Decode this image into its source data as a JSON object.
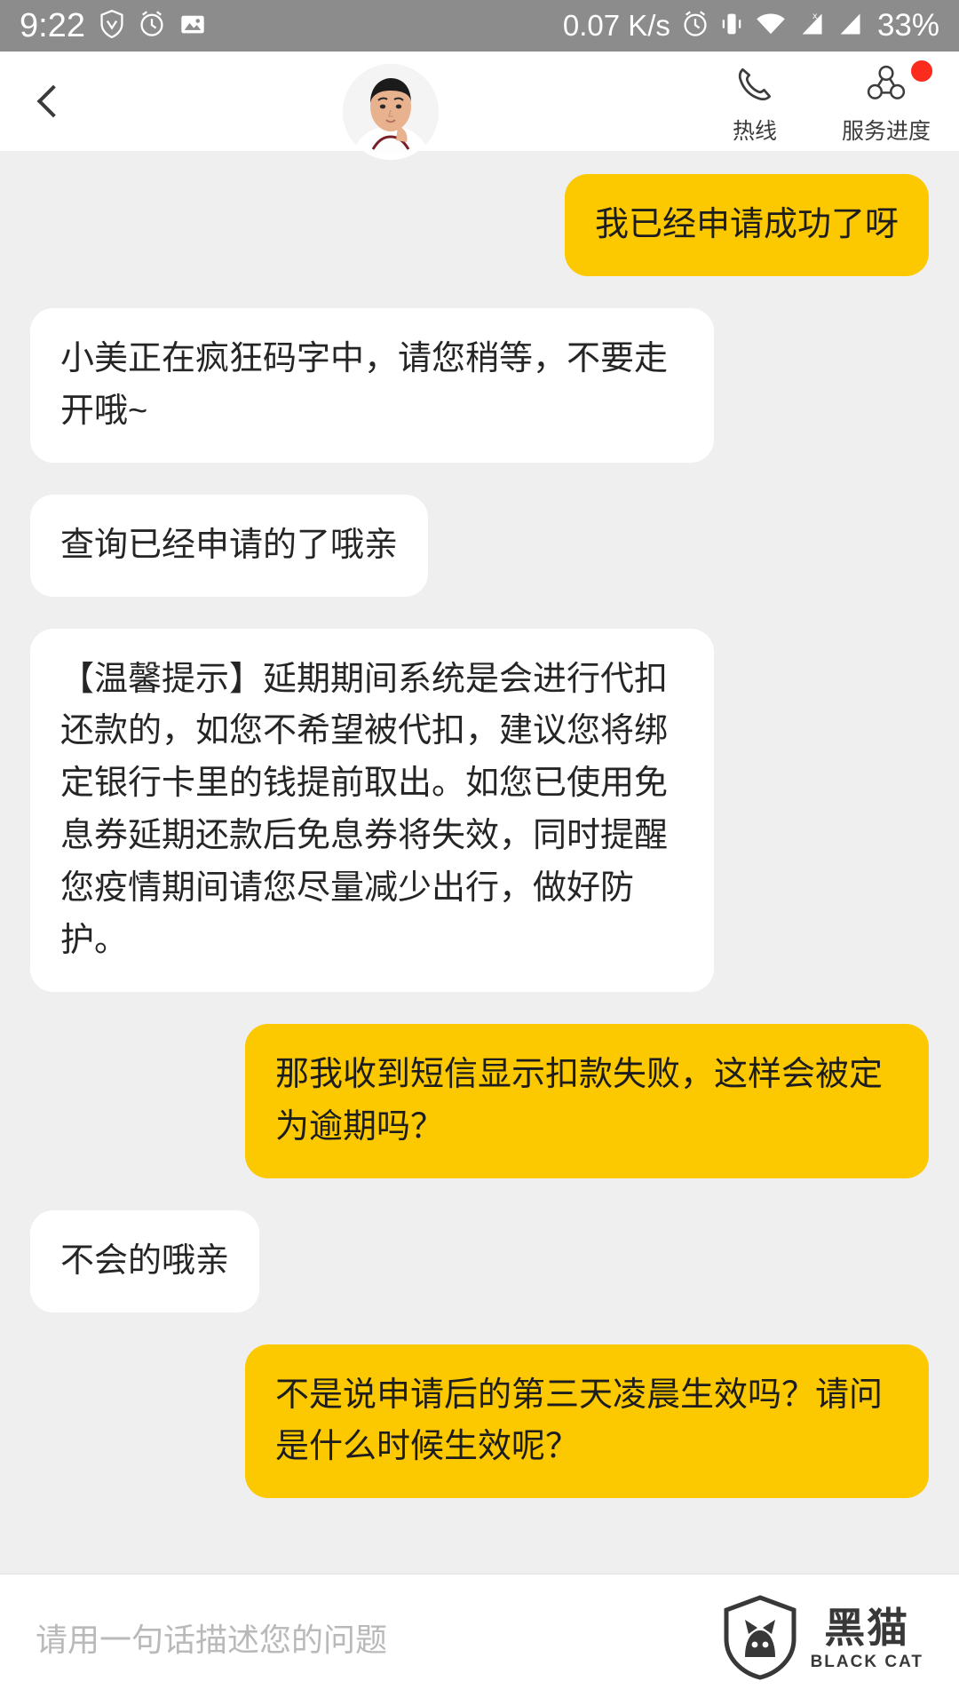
{
  "status_bar": {
    "time": "9:22",
    "left_icons": [
      "shield-icon",
      "alarm-clock-icon",
      "photo-icon"
    ],
    "network_speed": "0.07 K/s",
    "right_icons": [
      "alarm-clock-icon",
      "vibrate-icon",
      "wifi-icon",
      "signal-icon",
      "signal-icon"
    ],
    "battery": "33%"
  },
  "header": {
    "back_icon": "back-chevron-icon",
    "avatar": "agent-avatar",
    "actions": [
      {
        "icon": "phone-icon",
        "label": "热线",
        "badge": false
      },
      {
        "icon": "service-progress-icon",
        "label": "服务进度",
        "badge": true
      }
    ]
  },
  "chat": {
    "messages": [
      {
        "from": "user",
        "text": "我已经申请成功了呀"
      },
      {
        "from": "bot",
        "text": "小美正在疯狂码字中，请您稍等，不要走开哦~"
      },
      {
        "from": "bot",
        "text": "查询已经申请的了哦亲"
      },
      {
        "from": "bot",
        "text": "【温馨提示】延期期间系统是会进行代扣还款的，如您不希望被代扣，建议您将绑定银行卡里的钱提前取出。如您已使用免息券延期还款后免息券将失效，同时提醒您疫情期间请您尽量减少出行，做好防护。"
      },
      {
        "from": "user",
        "text": "那我收到短信显示扣款失败，这样会被定为逾期吗？"
      },
      {
        "from": "bot",
        "text": "不会的哦亲"
      },
      {
        "from": "user",
        "text": "不是说申请后的第三天凌晨生效吗？请问是什么时候生效呢？"
      }
    ]
  },
  "input_bar": {
    "placeholder": "请用一句话描述您的问题",
    "value": ""
  },
  "watermark": {
    "cn": "黑猫",
    "en": "BLACK CAT",
    "icon": "black-cat-shield-icon"
  },
  "colors": {
    "user_bubble": "#fcc800",
    "bot_bubble": "#ffffff",
    "chat_background": "#efefef",
    "status_bar": "#8c8c8c",
    "badge": "#fb2b1d"
  }
}
